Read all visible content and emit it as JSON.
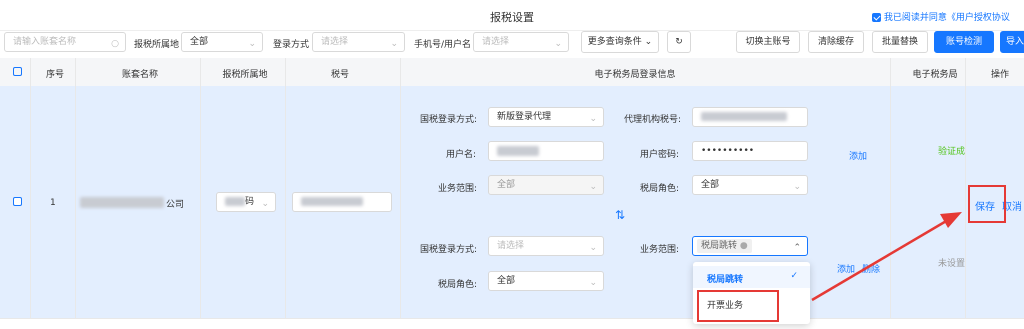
{
  "header": {
    "title": "报税设置",
    "agree_text": "我已阅读并同意《用户授权协议"
  },
  "filters": {
    "account_placeholder": "请输入账套名称",
    "region_label": "报税所属地",
    "region_value": "全部",
    "login_label": "登录方式",
    "login_placeholder": "请选择",
    "phone_label": "手机号/用户名",
    "phone_placeholder": "请选择",
    "more_label": "更多查询条件"
  },
  "actions": {
    "switch_main": "切换主账号",
    "clear_cache": "清除缓存",
    "batch_replace": "批量替换",
    "account_check": "账号检测",
    "import": "导入"
  },
  "columns": [
    "序号",
    "账套名称",
    "报税所属地",
    "税号",
    "电子税务局登录信息",
    "电子税务局",
    "操作"
  ],
  "row": {
    "index": "1",
    "company_suffix": "公司",
    "region_suffix": "码",
    "block1": {
      "login_method_label": "国税登录方式:",
      "login_method_value": "新版登录代理",
      "agent_tax_label": "代理机构税号:",
      "username_label": "用户名:",
      "password_label": "用户密码:",
      "password_value": "••••••••••",
      "scope_label": "业务范围:",
      "scope_value": "全部",
      "role_label": "税局角色:",
      "role_value": "全部",
      "add_link": "添加",
      "status": "验证成"
    },
    "block2": {
      "login_method_label": "国税登录方式:",
      "login_method_placeholder": "请选择",
      "scope_label": "业务范围:",
      "scope_tag": "税局跳转",
      "role_label": "税局角色:",
      "role_value": "全部",
      "add_link": "添加",
      "delete_link": "删除",
      "status": "未设置"
    },
    "swap_icon": "⇅",
    "save": "保存",
    "cancel": "取消"
  },
  "dropdown": {
    "options": [
      "税局跳转",
      "开票业务"
    ],
    "selected": "税局跳转"
  },
  "colors": {
    "primary": "#1677ff",
    "row_bg": "#e3eefe",
    "annotation": "#e53935",
    "success": "#52c41a"
  }
}
